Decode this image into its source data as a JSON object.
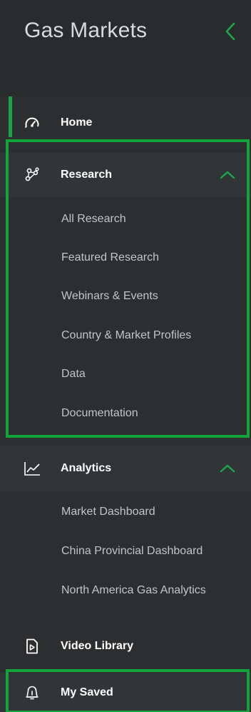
{
  "header": {
    "title": "Gas Markets"
  },
  "nav": {
    "home": {
      "label": "Home"
    },
    "research": {
      "label": "Research",
      "items": [
        {
          "label": "All Research"
        },
        {
          "label": "Featured Research"
        },
        {
          "label": "Webinars & Events"
        },
        {
          "label": "Country & Market Profiles"
        },
        {
          "label": "Data"
        },
        {
          "label": "Documentation"
        }
      ]
    },
    "analytics": {
      "label": "Analytics",
      "items": [
        {
          "label": "Market Dashboard"
        },
        {
          "label": "China Provincial Dashboard"
        },
        {
          "label": "North America Gas Analytics"
        }
      ]
    },
    "video_library": {
      "label": "Video Library"
    },
    "my_saved": {
      "label": "My Saved"
    }
  },
  "colors": {
    "background": "#2c2e30",
    "accent": "#16a34a",
    "highlight_border": "#12a33a",
    "text_primary": "#ffffff",
    "text_secondary": "#c2c5c7"
  },
  "icons": {
    "collapse": "chevron-left-icon",
    "home": "home-gauge-icon",
    "research": "research-nodes-icon",
    "analytics": "line-chart-icon",
    "video_library": "video-file-icon",
    "my_saved": "bell-saved-icon",
    "expanded": "chevron-up-icon"
  }
}
